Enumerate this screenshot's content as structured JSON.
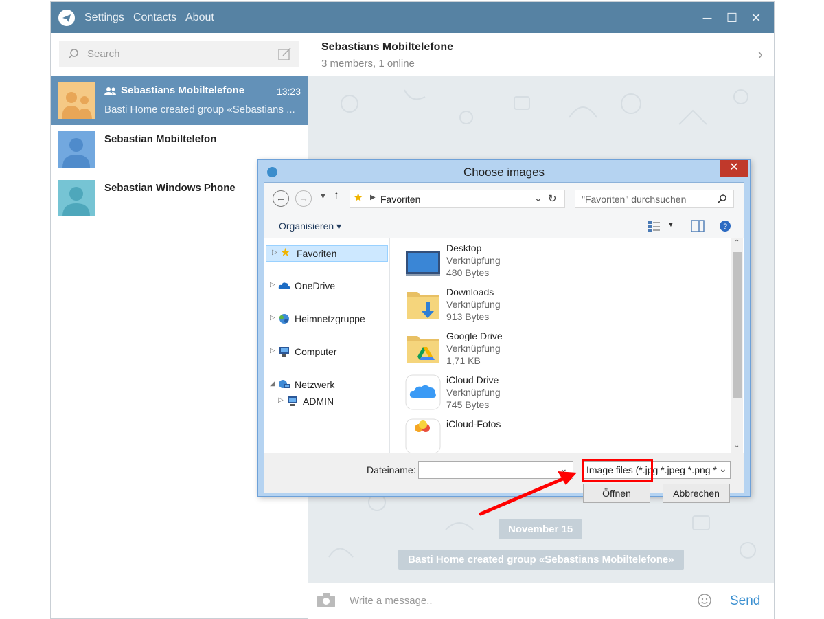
{
  "app": {
    "menu": [
      "Settings",
      "Contacts",
      "About"
    ],
    "search_placeholder": "Search",
    "colors": {
      "titlebar": "#5682a3",
      "active_chat": "#6391b8",
      "send": "#3a8fd0",
      "annotation": "#ff0000"
    }
  },
  "chats": [
    {
      "name": "Sebastians Mobiltelefone",
      "time": "13:23",
      "preview": "Basti Home created group «Sebastians ...",
      "is_group": true,
      "active": true
    },
    {
      "name": "Sebastian Mobiltelefon",
      "time": "",
      "preview": "",
      "is_group": false,
      "active": false
    },
    {
      "name": "Sebastian Windows Phone",
      "time": "",
      "preview": "",
      "is_group": false,
      "active": false
    }
  ],
  "chat_header": {
    "title": "Sebastians Mobiltelefone",
    "subtitle": "3 members, 1 online"
  },
  "messages": {
    "date_badge": "November 15",
    "service": "Basti Home created group «Sebastians Mobiltelefone»"
  },
  "composer": {
    "placeholder": "Write a message..",
    "send_label": "Send"
  },
  "dialog": {
    "title": "Choose images",
    "address": "Favoriten",
    "search_placeholder": "\"Favoriten\" durchsuchen",
    "organize": "Organisieren",
    "nav": [
      {
        "label": "Favoriten",
        "selected": true,
        "icon": "star-icon"
      },
      {
        "label": "OneDrive",
        "selected": false,
        "icon": "cloud-icon"
      },
      {
        "label": "Heimnetzgruppe",
        "selected": false,
        "icon": "homegroup-icon"
      },
      {
        "label": "Computer",
        "selected": false,
        "icon": "computer-icon"
      },
      {
        "label": "Netzwerk",
        "selected": false,
        "icon": "network-icon"
      },
      {
        "label": "ADMIN",
        "selected": false,
        "icon": "computer-icon"
      }
    ],
    "files": [
      {
        "name": "Desktop",
        "type": "Verknüpfung",
        "size": "480 Bytes",
        "icon": "desktop-icon"
      },
      {
        "name": "Downloads",
        "type": "Verknüpfung",
        "size": "913 Bytes",
        "icon": "downloads-folder-icon"
      },
      {
        "name": "Google Drive",
        "type": "Verknüpfung",
        "size": "1,71 KB",
        "icon": "google-drive-folder-icon"
      },
      {
        "name": "iCloud Drive",
        "type": "Verknüpfung",
        "size": "745 Bytes",
        "icon": "icloud-icon"
      },
      {
        "name": "iCloud-Fotos",
        "type": "",
        "size": "",
        "icon": "icloud-photos-icon"
      }
    ],
    "filename_label": "Dateiname:",
    "filename_value": "",
    "filetype": "Image files (*.jpg *.jpeg *.png *",
    "open_label": "Öffnen",
    "cancel_label": "Abbrechen"
  }
}
